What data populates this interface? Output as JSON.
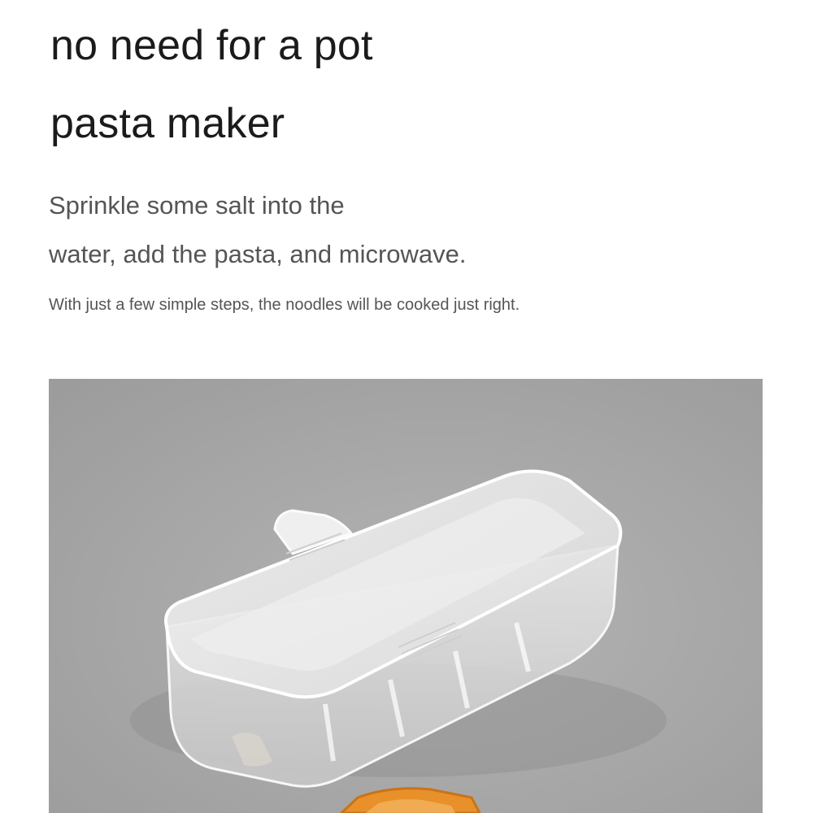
{
  "headline": {
    "line1": "no need for a pot",
    "line2": "pasta maker"
  },
  "subtitle": {
    "line1": "Sprinkle some salt into the",
    "line2": "water, add the pasta, and microwave."
  },
  "caption": "With just a few simple steps, the noodles will be cooked just right.",
  "colors": {
    "headline_text": "#1b1b1b",
    "body_text": "#555555",
    "photo_background": "#a5a5a5",
    "accent_orange": "#e8902a"
  },
  "photo": {
    "subject": "clear-plastic-pasta-cooker",
    "accent_item": "orange-lid"
  }
}
